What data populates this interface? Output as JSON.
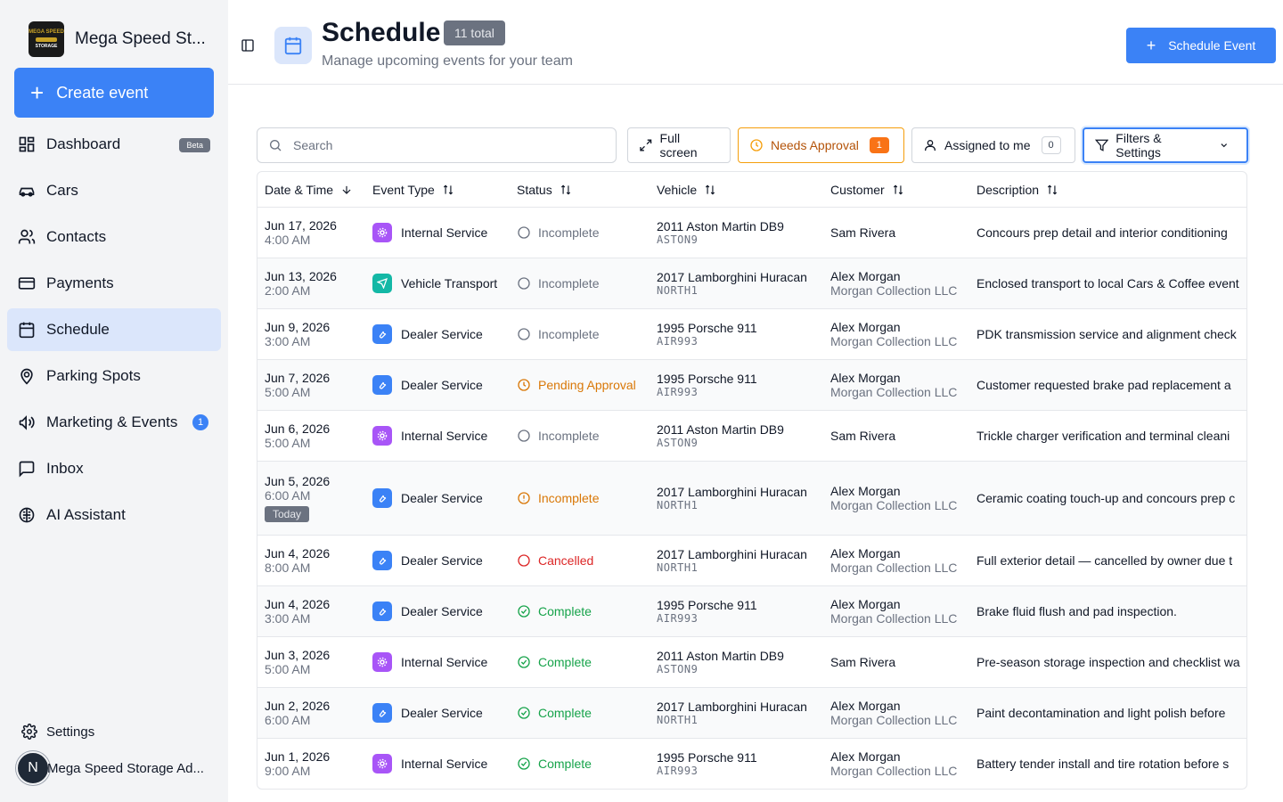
{
  "sidebar": {
    "brand_name": "Mega Speed St...",
    "logo_top": "MEGA SPEED",
    "logo_bottom": "STORAGE",
    "create_label": "Create event",
    "items": [
      {
        "label": "Dashboard",
        "badge": "Beta",
        "icon": "dashboard-icon"
      },
      {
        "label": "Cars",
        "icon": "car-icon"
      },
      {
        "label": "Contacts",
        "icon": "users-icon"
      },
      {
        "label": "Payments",
        "icon": "credit-card-icon"
      },
      {
        "label": "Schedule",
        "icon": "calendar-icon",
        "active": true
      },
      {
        "label": "Parking Spots",
        "icon": "map-pin-icon"
      },
      {
        "label": "Marketing & Events",
        "badge": "1",
        "icon": "megaphone-icon"
      },
      {
        "label": "Inbox",
        "icon": "message-square-icon"
      },
      {
        "label": "AI Assistant",
        "icon": "brain-icon"
      }
    ],
    "settings_label": "Settings",
    "user_initial": "N",
    "user_name": "Mega Speed Storage Ad..."
  },
  "header": {
    "title": "Schedule",
    "total_badge": "11 total",
    "subtitle": "Manage upcoming events for your team",
    "schedule_button": "Schedule Event"
  },
  "toolbar": {
    "search_placeholder": "Search",
    "full_screen": "Full screen",
    "needs_approval": "Needs Approval",
    "needs_approval_count": "1",
    "assigned_to_me": "Assigned to me",
    "assigned_count": "0",
    "filters": "Filters & Settings"
  },
  "table": {
    "columns": [
      "Date & Time",
      "Event Type",
      "Status",
      "Vehicle",
      "Customer",
      "Description"
    ],
    "rows": [
      {
        "date": "Jun 17, 2026",
        "time": "4:00 AM",
        "type": "Internal Service",
        "status": "Incomplete",
        "vehicle": "2011 Aston Martin DB9",
        "plate": "ASTON9",
        "customer": "Sam Rivera",
        "company": "",
        "description": "Concours prep detail and interior conditioning"
      },
      {
        "date": "Jun 13, 2026",
        "time": "2:00 AM",
        "type": "Vehicle Transport",
        "status": "Incomplete",
        "vehicle": "2017 Lamborghini Huracan",
        "plate": "NORTH1",
        "customer": "Alex Morgan",
        "company": "Morgan Collection LLC",
        "description": "Enclosed transport to local Cars & Coffee event"
      },
      {
        "date": "Jun 9, 2026",
        "time": "3:00 AM",
        "type": "Dealer Service",
        "status": "Incomplete",
        "vehicle": "1995 Porsche 911",
        "plate": "AIR993",
        "customer": "Alex Morgan",
        "company": "Morgan Collection LLC",
        "description": "PDK transmission service and alignment check"
      },
      {
        "date": "Jun 7, 2026",
        "time": "5:00 AM",
        "type": "Dealer Service",
        "status": "Pending Approval",
        "vehicle": "1995 Porsche 911",
        "plate": "AIR993",
        "customer": "Alex Morgan",
        "company": "Morgan Collection LLC",
        "description": "Customer requested brake pad replacement a"
      },
      {
        "date": "Jun 6, 2026",
        "time": "5:00 AM",
        "type": "Internal Service",
        "status": "Incomplete",
        "vehicle": "2011 Aston Martin DB9",
        "plate": "ASTON9",
        "customer": "Sam Rivera",
        "company": "",
        "description": "Trickle charger verification and terminal cleani"
      },
      {
        "date": "Jun 5, 2026",
        "time": "6:00 AM",
        "today": "Today",
        "type": "Dealer Service",
        "status": "Incomplete",
        "status_variant": "overdue",
        "vehicle": "2017 Lamborghini Huracan",
        "plate": "NORTH1",
        "customer": "Alex Morgan",
        "company": "Morgan Collection LLC",
        "description": "Ceramic coating touch-up and concours prep c"
      },
      {
        "date": "Jun 4, 2026",
        "time": "8:00 AM",
        "type": "Dealer Service",
        "status": "Cancelled",
        "vehicle": "2017 Lamborghini Huracan",
        "plate": "NORTH1",
        "customer": "Alex Morgan",
        "company": "Morgan Collection LLC",
        "description": "Full exterior detail — cancelled by owner due t"
      },
      {
        "date": "Jun 4, 2026",
        "time": "3:00 AM",
        "type": "Dealer Service",
        "status": "Complete",
        "vehicle": "1995 Porsche 911",
        "plate": "AIR993",
        "customer": "Alex Morgan",
        "company": "Morgan Collection LLC",
        "description": "Brake fluid flush and pad inspection."
      },
      {
        "date": "Jun 3, 2026",
        "time": "5:00 AM",
        "type": "Internal Service",
        "status": "Complete",
        "vehicle": "2011 Aston Martin DB9",
        "plate": "ASTON9",
        "customer": "Sam Rivera",
        "company": "",
        "description": "Pre-season storage inspection and checklist wa"
      },
      {
        "date": "Jun 2, 2026",
        "time": "6:00 AM",
        "type": "Dealer Service",
        "status": "Complete",
        "vehicle": "2017 Lamborghini Huracan",
        "plate": "NORTH1",
        "customer": "Alex Morgan",
        "company": "Morgan Collection LLC",
        "description": "Paint decontamination and light polish before"
      },
      {
        "date": "Jun 1, 2026",
        "time": "9:00 AM",
        "type": "Internal Service",
        "status": "Complete",
        "vehicle": "1995 Porsche 911",
        "plate": "AIR993",
        "customer": "Alex Morgan",
        "company": "Morgan Collection LLC",
        "description": "Battery tender install and tire rotation before s"
      }
    ]
  },
  "colors": {
    "accent": "#3b82f6",
    "internal_service": "#a855f7",
    "vehicle_transport": "#14b8a6",
    "dealer_service": "#3b82f6",
    "incomplete": "#6b7280",
    "pending": "#d97706",
    "cancelled": "#dc2626",
    "complete": "#16a34a"
  }
}
